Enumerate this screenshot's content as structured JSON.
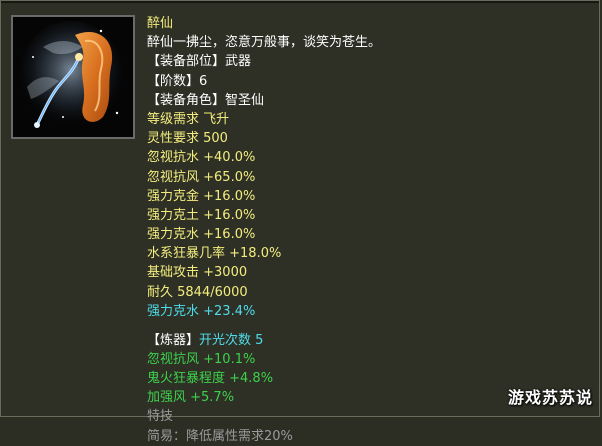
{
  "colors": {
    "yellow": "#f3ed7e",
    "white": "#ffffff",
    "green": "#3dd04c",
    "cyan": "#4fdcea",
    "gray": "#9a9a9a"
  },
  "item": {
    "icon": "whisk-icon",
    "name": "醉仙",
    "lines": [
      {
        "segments": [
          {
            "text": "醉仙",
            "color": "#f3ed7e"
          }
        ]
      },
      {
        "segments": [
          {
            "text": "醉仙一拂尘，恣意万般事，谈笑为苍生。",
            "color": "#ffffff"
          }
        ]
      },
      {
        "segments": [
          {
            "text": "【装备部位】武器",
            "color": "#ffffff"
          }
        ]
      },
      {
        "segments": [
          {
            "text": "【阶数】6",
            "color": "#ffffff"
          }
        ]
      },
      {
        "segments": [
          {
            "text": "【装备角色】智圣仙",
            "color": "#ffffff"
          }
        ]
      },
      {
        "segments": [
          {
            "text": "等级需求 飞升",
            "color": "#f3ed7e"
          }
        ]
      },
      {
        "segments": [
          {
            "text": "灵性要求 500",
            "color": "#f3ed7e"
          }
        ]
      },
      {
        "segments": [
          {
            "text": "忽视抗水 +40.0%",
            "color": "#f3ed7e"
          }
        ]
      },
      {
        "segments": [
          {
            "text": "忽视抗风 +65.0%",
            "color": "#f3ed7e"
          }
        ]
      },
      {
        "segments": [
          {
            "text": "强力克金 +16.0%",
            "color": "#f3ed7e"
          }
        ]
      },
      {
        "segments": [
          {
            "text": "强力克土 +16.0%",
            "color": "#f3ed7e"
          }
        ]
      },
      {
        "segments": [
          {
            "text": "强力克水 +16.0%",
            "color": "#f3ed7e"
          }
        ]
      },
      {
        "segments": [
          {
            "text": "水系狂暴几率 +18.0%",
            "color": "#f3ed7e"
          }
        ]
      },
      {
        "segments": [
          {
            "text": "基础攻击 +3000",
            "color": "#f3ed7e"
          }
        ]
      },
      {
        "segments": [
          {
            "text": "耐久 5844/6000",
            "color": "#f3ed7e"
          }
        ]
      },
      {
        "segments": [
          {
            "text": "强力克水 +23.4%",
            "color": "#4fdcea"
          }
        ]
      },
      {
        "gap": true
      },
      {
        "segments": [
          {
            "text": "【炼器】",
            "color": "#ffffff"
          },
          {
            "text": "开光次数 5",
            "color": "#4fdcea"
          }
        ]
      },
      {
        "segments": [
          {
            "text": "忽视抗风 +10.1%",
            "color": "#3dd04c"
          }
        ]
      },
      {
        "segments": [
          {
            "text": "鬼火狂暴程度 +4.8%",
            "color": "#3dd04c"
          }
        ]
      },
      {
        "segments": [
          {
            "text": "加强风 +5.7%",
            "color": "#3dd04c"
          }
        ]
      },
      {
        "segments": [
          {
            "text": "特技",
            "color": "#9a9a9a"
          }
        ]
      },
      {
        "segments": [
          {
            "text": "简易：降低属性需求20%",
            "color": "#9a9a9a"
          }
        ]
      }
    ]
  },
  "watermark": "游戏苏苏说"
}
